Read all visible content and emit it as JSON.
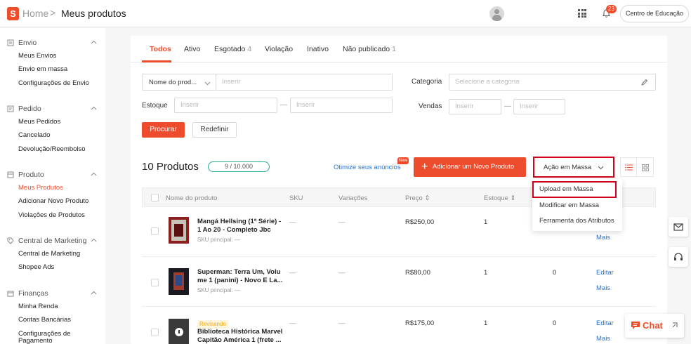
{
  "header": {
    "logo_letter": "S",
    "home": "Home",
    "separator": ">",
    "title": "Meus produtos",
    "notification_count": "23",
    "education_label": "Centro de Educação"
  },
  "sidebar": {
    "groups": [
      {
        "title": "Envio",
        "items": [
          "Meus Envios",
          "Envio em massa",
          "Configurações de Envio"
        ]
      },
      {
        "title": "Pedido",
        "items": [
          "Meus Pedidos",
          "Cancelado",
          "Devolução/Reembolso"
        ]
      },
      {
        "title": "Produto",
        "items": [
          "Meus Produtos",
          "Adicionar Novo Produto",
          "Violações de Produtos"
        ]
      },
      {
        "title": "Central de Marketing",
        "items": [
          "Central de Marketing",
          "Shopee Ads"
        ]
      },
      {
        "title": "Finanças",
        "items": [
          "Minha Renda",
          "Contas Bancárias",
          "Configurações de",
          "Pagamento"
        ]
      }
    ]
  },
  "tabs": [
    {
      "label": "Todos",
      "count": ""
    },
    {
      "label": "Ativo",
      "count": ""
    },
    {
      "label": "Esgotado",
      "count": "4"
    },
    {
      "label": "Violação",
      "count": ""
    },
    {
      "label": "Inativo",
      "count": ""
    },
    {
      "label": "Não publicado",
      "count": "1"
    }
  ],
  "filters": {
    "name_select": "Nome do prod...",
    "name_placeholder": "Inserir",
    "category_label": "Categoria",
    "category_placeholder": "Selecione a categoria",
    "stock_label": "Estoque",
    "stock_min_placeholder": "Inserir",
    "stock_max_placeholder": "Inserir",
    "sales_label": "Vendas",
    "sales_min_placeholder": "Inserir",
    "sales_max_placeholder": "Inserir",
    "dash": "—",
    "search_button": "Procurar",
    "reset_button": "Redefinir"
  },
  "summary": {
    "product_count": "10 Produtos",
    "quota": "9 / 10.000",
    "optimize_link": "Otimize seus anúncios",
    "new_badge": "New",
    "add_button": "Adicionar um Novo Produto",
    "bulk_button": "Ação em Massa"
  },
  "bulk_menu": [
    "Upload em Massa",
    "Modificar em Massa",
    "Ferramenta dos Atributos"
  ],
  "table": {
    "headers": [
      "Nome do produto",
      "SKU",
      "Variações",
      "Preço",
      "Estoque"
    ],
    "rows": [
      {
        "status": "",
        "name": "Mangá Hellsing (1ª Série) - 1 Ao 20 - Completo Jbc",
        "sku": "SKU principal: —",
        "sku_col": "—",
        "variations": "—",
        "price": "R$250,00",
        "stock": "1",
        "sales": "",
        "edit": "",
        "more": "Mais"
      },
      {
        "status": "",
        "name": "Superman: Terra Um, Volu me 1 (panini) - Novo E La...",
        "sku": "SKU principal: —",
        "sku_col": "—",
        "variations": "—",
        "price": "R$80,00",
        "stock": "1",
        "sales": "0",
        "edit": "Editar",
        "more": "Mais"
      },
      {
        "status": "Revisando",
        "name": "Biblioteca Histórica Marvel Capitão América 1 (frete ...",
        "sku": "",
        "sku_col": "—",
        "variations": "—",
        "price": "R$175,00",
        "stock": "1",
        "sales": "0",
        "edit": "Editar",
        "more": "Mais"
      }
    ]
  },
  "chat_label": "Chat",
  "colors": {
    "brand": "#ee4d2d",
    "link": "#2673dd",
    "highlight_box": "#d0021b"
  }
}
